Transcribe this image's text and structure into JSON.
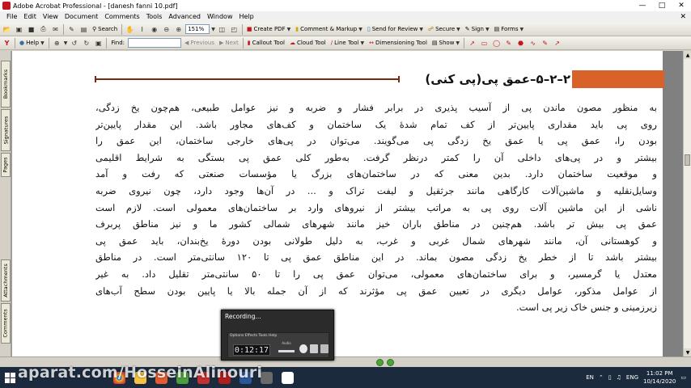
{
  "window": {
    "title": "Adobe Acrobat Professional - [danesh fanni 10.pdf]"
  },
  "menu": {
    "items": [
      "File",
      "Edit",
      "View",
      "Document",
      "Comments",
      "Tools",
      "Advanced",
      "Window",
      "Help"
    ]
  },
  "toolbar1": {
    "search": "Search",
    "zoom": "151%",
    "create_pdf": "Create PDF",
    "comment_markup": "Comment & Markup",
    "send_review": "Send for Review",
    "secure": "Secure",
    "sign": "Sign",
    "forms": "Forms"
  },
  "toolbar2": {
    "help": "Help",
    "find_label": "Find:",
    "previous": "Previous",
    "next": "Next",
    "callout": "Callout Tool",
    "cloud": "Cloud Tool",
    "line": "Line Tool",
    "dimensioning": "Dimensioning Tool",
    "show": "Show"
  },
  "leftnav": {
    "tabs": [
      "Bookmarks",
      "Signatures",
      "Pages",
      "Attachments",
      "Comments"
    ]
  },
  "document": {
    "heading": "۲–۲–۵–عمق پی(پی کنی)",
    "lines": [
      "به منظور مصون ماندن پی از آسیب پذیری در برابر فشار و ضربه و نیز عوامل طبیعی، هم‌چون یخ زدگی،",
      "روی پی باید مقداری پایین‌تر از کف تمام شدهٔ یک ساختمان و کف‌های مجاور باشد. این مقدار پایین‌تر",
      "بودن را، عمق پی یا عمق یخ زدگی پی می‌گویند. می‌توان در پی‌های خارجی ساختمان، این عمق را",
      "بیشتر و در پی‌های داخلی آن را کمتر درنظر گرفت. به‌طور کلی عمق پی بستگی به شرایط اقلیمی",
      "و موقعیت ساختمان دارد. بدین معنی که در ساختمان‌های بزرگ یا مؤسسات صنعتی که رفت و آمد",
      "وسایل‌نقلیه و ماشین‌آلات کارگاهی مانند جرثقیل و لیفت تراک و ... در آن‌ها وجود دارد، چون نیروی ضربه",
      "ناشی از این ماشین آلات روی پی به مراتب بیشتر از نیروهای وارد بر ساختمان‌های معمولی است. لازم است",
      "عمق پی بیش تر باشد. هم‌چنین در مناطق باران خیز مانند شهرهای شمالی کشور ما و نیز مناطق پربرف",
      "و کوهستانی آن، مانند شهرهای شمال غربی و غرب، به دلیل طولانی بودن دورهٔ یخ‌بندان، باید عمق پی",
      "بیشتر باشد تا از خطر یخ زدگی مصون بماند. در این مناطق عمق پی تا ۱۲۰ سانتی‌متر است. در مناطق",
      "معتدل یا گرمسیر، و برای ساختمان‌های معمولی، می‌توان عمق پی را تا ۵۰ سانتی‌متر تقلیل داد. به غیر",
      "از عوامل مذکور، عوامل دیگری در تعیین عمق پی مؤثرند که از آن جمله بالا یا پایین بودن سطح آب‌های",
      "زیرزمینی و جنس خاک زیر پی است."
    ]
  },
  "recorder": {
    "title": "Recording...",
    "menu": "Options  Effects  Tools  Help",
    "time": "0:12:17",
    "audio_label": "Audio"
  },
  "taskbar": {
    "watermark": "aparat.com/HosseinAlinouri",
    "lang1": "EN",
    "lang2": "ENG",
    "time": "11:02 PM",
    "date": "10/14/2020"
  },
  "colors": {
    "heading_bar": "#d9622b",
    "heading_rule": "#7b2a12",
    "taskbar": "#1b2b3d"
  }
}
